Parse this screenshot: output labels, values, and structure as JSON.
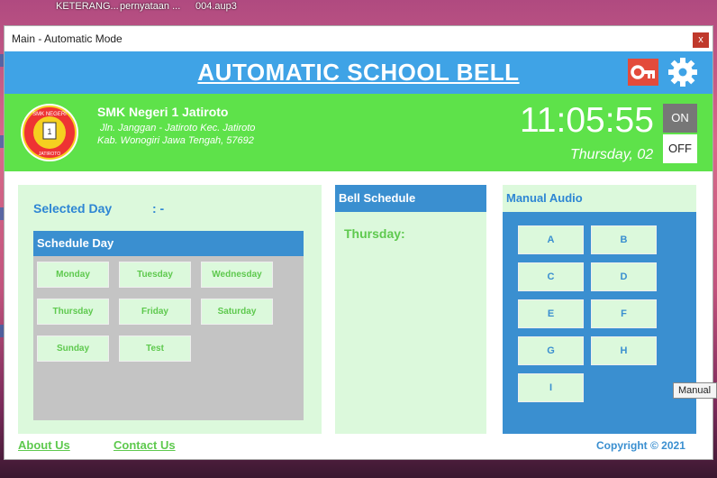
{
  "desktop": {
    "taskbar_items": [
      "KETERANG...",
      "pernyataan ...",
      "004.aup3"
    ]
  },
  "window": {
    "title": "Main - Automatic Mode",
    "close_label": "x"
  },
  "header": {
    "title": "AUTOMATIC SCHOOL BELL",
    "key_icon": "key-icon",
    "settings_icon": "gear-icon"
  },
  "school": {
    "logo_text_top": "SMK NEGERI",
    "logo_text_mid": "1",
    "logo_text_bottom": "JATIROTO",
    "name": "SMK Negeri 1 Jatiroto",
    "address_line1": "Jln. Janggan - Jatiroto Kec. Jatiroto",
    "address_line2": "Kab. Wonogiri Jawa Tengah, 57692"
  },
  "clock": {
    "time": "11:05:55",
    "date": "Thursday, 02",
    "on_label": "ON",
    "off_label": "OFF"
  },
  "schedule_panel": {
    "selected_day_label": "Selected Day",
    "selected_day_value": ": -",
    "header": "Schedule Day",
    "days": [
      "Monday",
      "Tuesday",
      "Wednesday",
      "Thursday",
      "Friday",
      "Saturday",
      "Sunday",
      "Test"
    ]
  },
  "bell_panel": {
    "header": "Bell Schedule",
    "day": "Thursday:"
  },
  "audio_panel": {
    "header": "Manual Audio",
    "buttons": [
      "A",
      "B",
      "C",
      "D",
      "E",
      "F",
      "G",
      "H",
      "I"
    ]
  },
  "footer": {
    "about": "About Us",
    "contact": "Contact Us",
    "copyright": "Copyright © 2021"
  },
  "tooltip": "Manual",
  "colors": {
    "header_blue": "#3fa3e6",
    "info_green": "#5ee24a",
    "panel_bg": "#dcf9dc",
    "accent_blue": "#3a8fd0",
    "text_green": "#5ec94e",
    "key_red": "#e34b3b"
  }
}
